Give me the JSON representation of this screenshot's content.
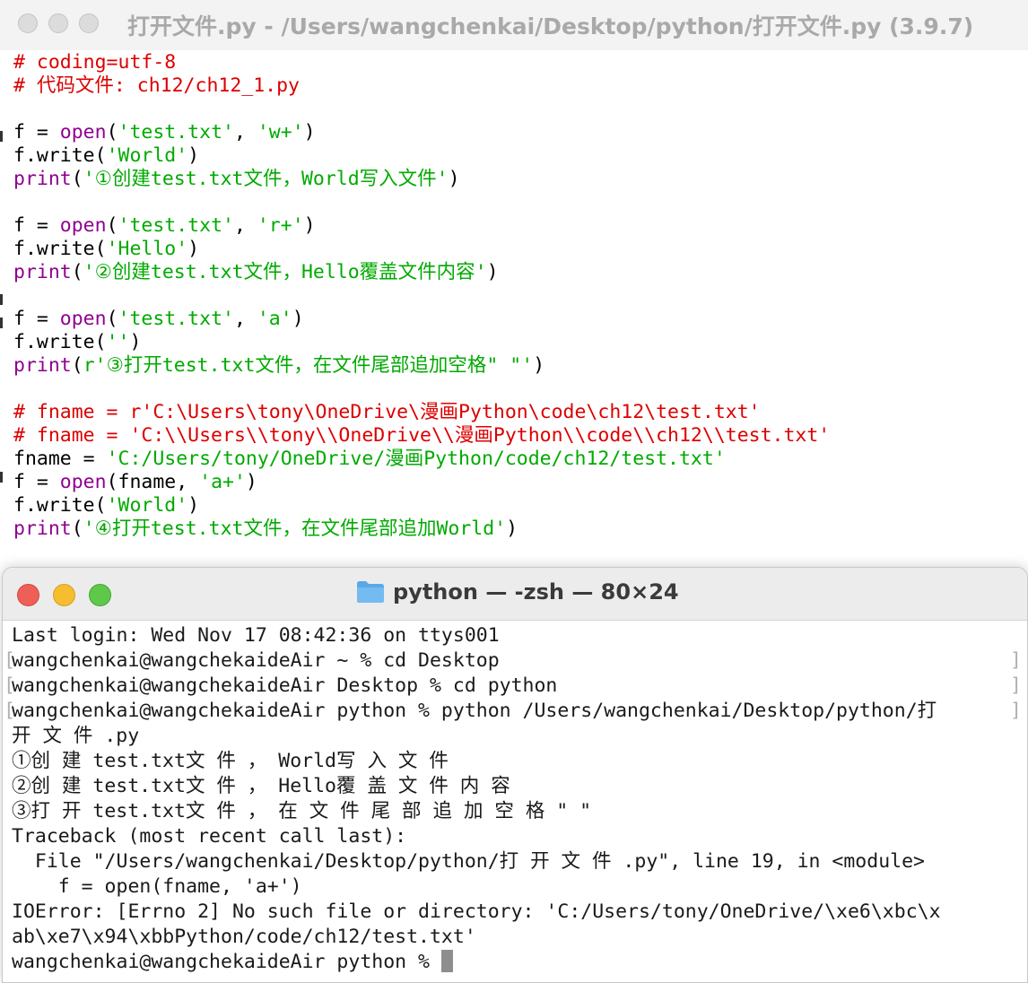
{
  "idle": {
    "title": "打开文件.py - /Users/wangchenkai/Desktop/python/打开文件.py (3.9.7)",
    "code_lines": [
      [
        {
          "t": "# coding=utf-8",
          "c": "comment"
        }
      ],
      [
        {
          "t": "# 代码文件: ch12/ch12_1.py",
          "c": "comment"
        }
      ],
      [],
      [
        {
          "t": "f = ",
          "c": "plain"
        },
        {
          "t": "open",
          "c": "builtin"
        },
        {
          "t": "(",
          "c": "plain"
        },
        {
          "t": "'test.txt'",
          "c": "string"
        },
        {
          "t": ", ",
          "c": "plain"
        },
        {
          "t": "'w+'",
          "c": "string"
        },
        {
          "t": ")",
          "c": "plain"
        }
      ],
      [
        {
          "t": "f.write(",
          "c": "plain"
        },
        {
          "t": "'World'",
          "c": "string"
        },
        {
          "t": ")",
          "c": "plain"
        }
      ],
      [
        {
          "t": "print",
          "c": "builtin"
        },
        {
          "t": "(",
          "c": "plain"
        },
        {
          "t": "'①创建test.txt文件，World写入文件'",
          "c": "string"
        },
        {
          "t": ")",
          "c": "plain"
        }
      ],
      [],
      [
        {
          "t": "f = ",
          "c": "plain"
        },
        {
          "t": "open",
          "c": "builtin"
        },
        {
          "t": "(",
          "c": "plain"
        },
        {
          "t": "'test.txt'",
          "c": "string"
        },
        {
          "t": ", ",
          "c": "plain"
        },
        {
          "t": "'r+'",
          "c": "string"
        },
        {
          "t": ")",
          "c": "plain"
        }
      ],
      [
        {
          "t": "f.write(",
          "c": "plain"
        },
        {
          "t": "'Hello'",
          "c": "string"
        },
        {
          "t": ")",
          "c": "plain"
        }
      ],
      [
        {
          "t": "print",
          "c": "builtin"
        },
        {
          "t": "(",
          "c": "plain"
        },
        {
          "t": "'②创建test.txt文件，Hello覆盖文件内容'",
          "c": "string"
        },
        {
          "t": ")",
          "c": "plain"
        }
      ],
      [],
      [
        {
          "t": "f = ",
          "c": "plain"
        },
        {
          "t": "open",
          "c": "builtin"
        },
        {
          "t": "(",
          "c": "plain"
        },
        {
          "t": "'test.txt'",
          "c": "string"
        },
        {
          "t": ", ",
          "c": "plain"
        },
        {
          "t": "'a'",
          "c": "string"
        },
        {
          "t": ")",
          "c": "plain"
        }
      ],
      [
        {
          "t": "f.write(",
          "c": "plain"
        },
        {
          "t": "''",
          "c": "string"
        },
        {
          "t": ")",
          "c": "plain"
        }
      ],
      [
        {
          "t": "print",
          "c": "builtin"
        },
        {
          "t": "(",
          "c": "plain"
        },
        {
          "t": "r'③打开test.txt文件，在文件尾部追加空格\" \"'",
          "c": "string"
        },
        {
          "t": ")",
          "c": "plain"
        }
      ],
      [],
      [
        {
          "t": "# fname = r'C:\\Users\\tony\\OneDrive\\漫画Python\\code\\ch12\\test.txt'",
          "c": "comment"
        }
      ],
      [
        {
          "t": "# fname = 'C:\\\\Users\\\\tony\\\\OneDrive\\\\漫画Python\\\\code\\\\ch12\\\\test.txt'",
          "c": "comment"
        }
      ],
      [
        {
          "t": "fname = ",
          "c": "plain"
        },
        {
          "t": "'C:/Users/tony/OneDrive/漫画Python/code/ch12/test.txt'",
          "c": "string"
        }
      ],
      [
        {
          "t": "f = ",
          "c": "plain"
        },
        {
          "t": "open",
          "c": "builtin"
        },
        {
          "t": "(fname, ",
          "c": "plain"
        },
        {
          "t": "'a+'",
          "c": "string"
        },
        {
          "t": ")",
          "c": "plain"
        }
      ],
      [
        {
          "t": "f.write(",
          "c": "plain"
        },
        {
          "t": "'World'",
          "c": "string"
        },
        {
          "t": ")",
          "c": "plain"
        }
      ],
      [
        {
          "t": "print",
          "c": "builtin"
        },
        {
          "t": "(",
          "c": "plain"
        },
        {
          "t": "'④打开test.txt文件，在文件尾部追加World'",
          "c": "string"
        },
        {
          "t": ")",
          "c": "plain"
        }
      ]
    ]
  },
  "terminal": {
    "title": "python — -zsh — 80×24",
    "lines": [
      {
        "text": "Last login: Wed Nov 17 08:42:36 on ttys001",
        "bracketed": false
      },
      {
        "text": "wangchenkai@wangchekaideAir ~ % cd Desktop",
        "bracketed": true
      },
      {
        "text": "wangchenkai@wangchekaideAir Desktop % cd python",
        "bracketed": true
      },
      {
        "text": "wangchenkai@wangchekaideAir python % python /Users/wangchenkai/Desktop/python/打",
        "bracketed": true
      },
      {
        "text": "开 文 件 .py",
        "bracketed": false
      },
      {
        "text": "①创 建 test.txt文 件 ， World写 入 文 件",
        "bracketed": false
      },
      {
        "text": "②创 建 test.txt文 件 ， Hello覆 盖 文 件 内 容",
        "bracketed": false
      },
      {
        "text": "③打 开 test.txt文 件 ， 在 文 件 尾 部 追 加 空 格 \" \"",
        "bracketed": false
      },
      {
        "text": "Traceback (most recent call last):",
        "bracketed": false
      },
      {
        "text": "  File \"/Users/wangchenkai/Desktop/python/打 开 文 件 .py\", line 19, in <module>",
        "bracketed": false
      },
      {
        "text": "    f = open(fname, 'a+')",
        "bracketed": false
      },
      {
        "text": "IOError: [Errno 2] No such file or directory: 'C:/Users/tony/OneDrive/\\xe6\\xbc\\x",
        "bracketed": false
      },
      {
        "text": "ab\\xe7\\x94\\xbbPython/code/ch12/test.txt'",
        "bracketed": false
      }
    ],
    "prompt": "wangchenkai@wangchekaideAir python % "
  }
}
